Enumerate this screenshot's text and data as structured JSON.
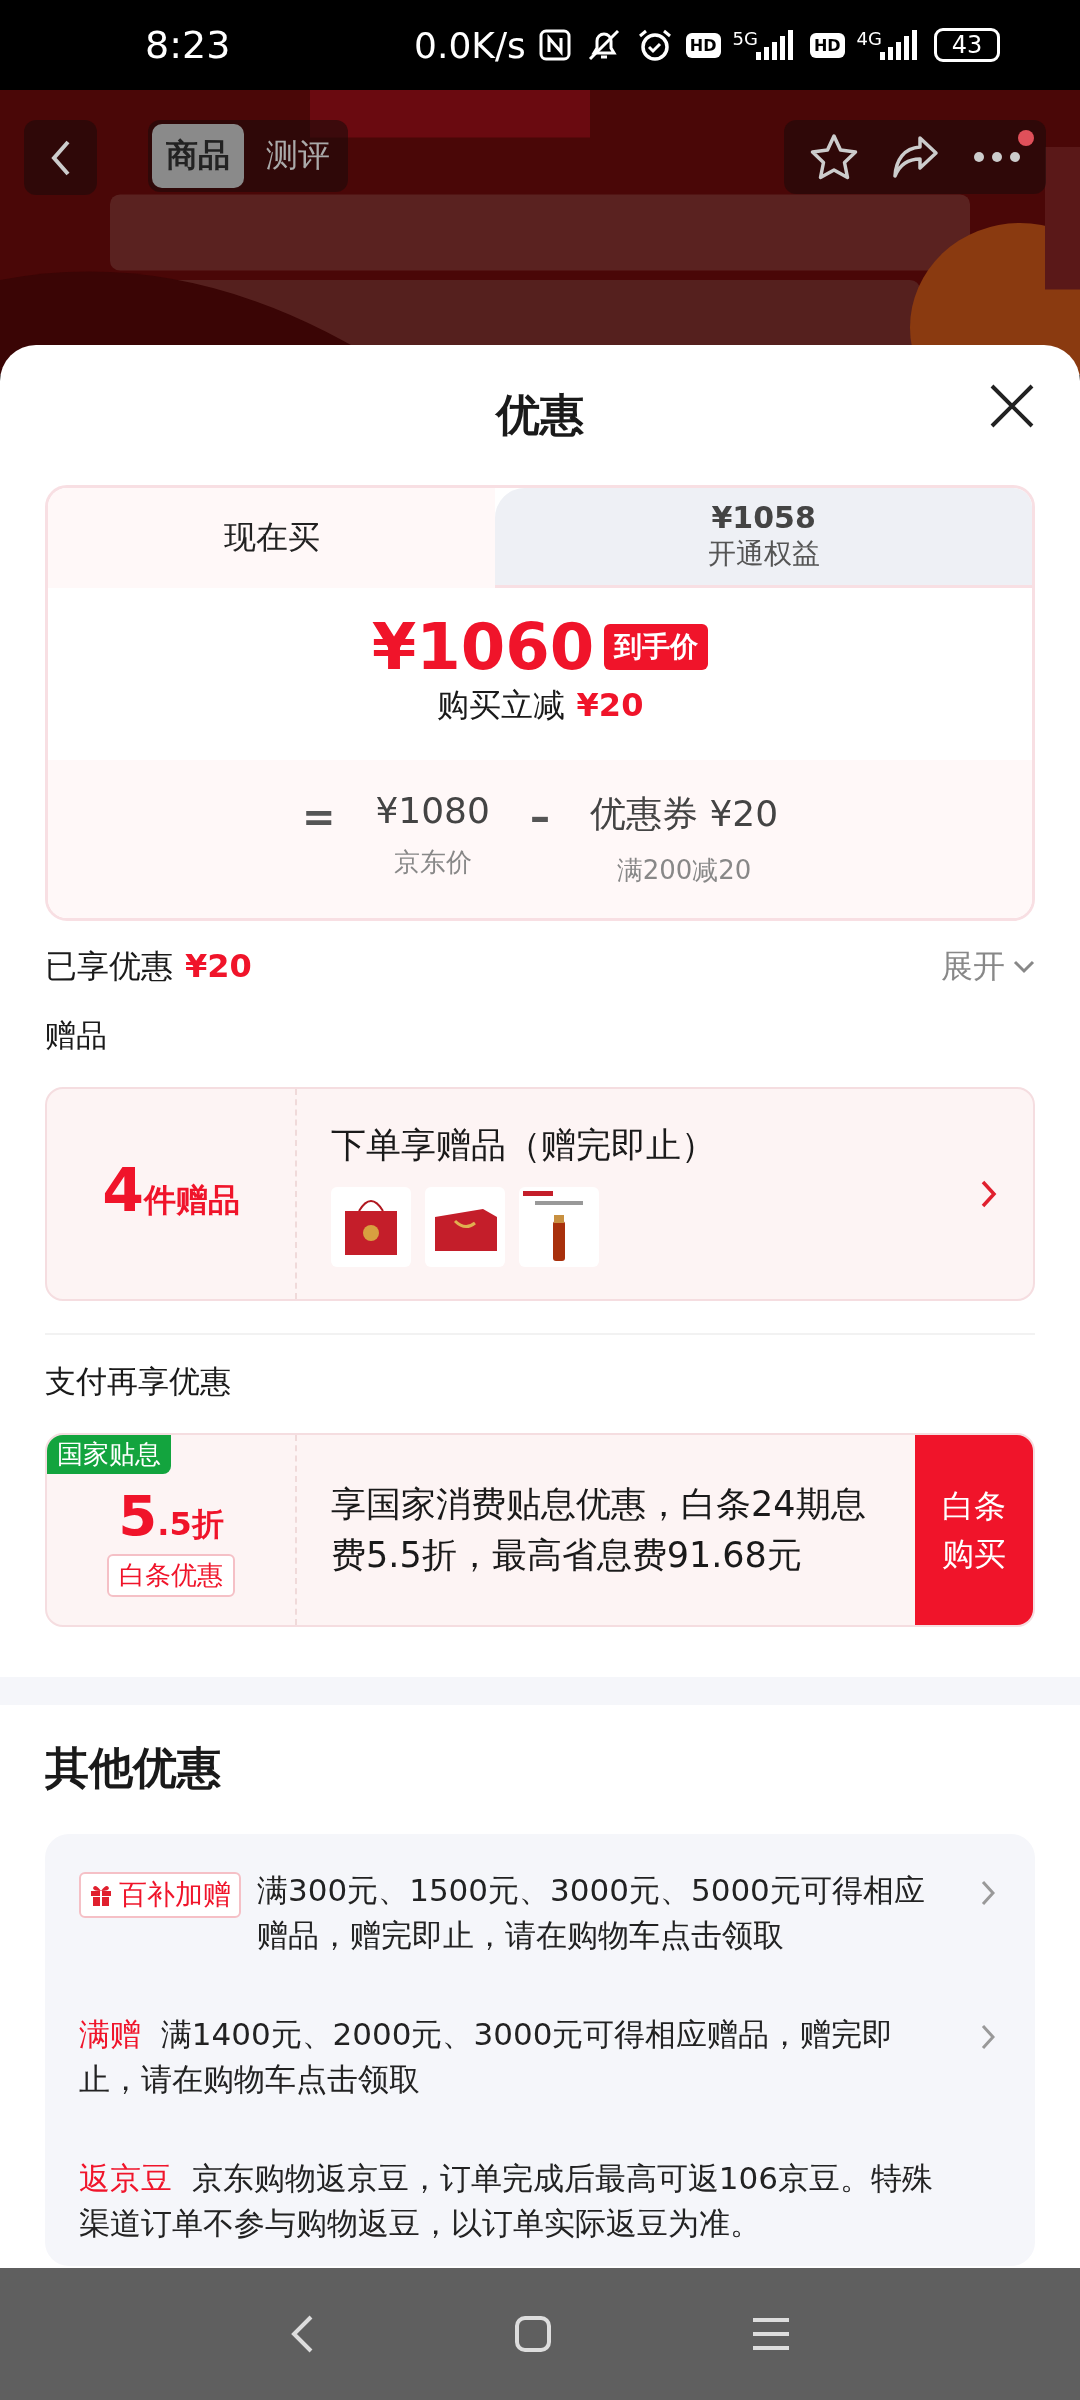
{
  "status_bar": {
    "time": "8:23",
    "network_speed": "0.0K/s",
    "sims": [
      {
        "badge": "HD",
        "network": "5G"
      },
      {
        "badge": "HD",
        "network": "4G"
      }
    ],
    "battery": "43"
  },
  "nav": {
    "tabs": [
      {
        "label": "商品",
        "selected": true
      },
      {
        "label": "测评",
        "selected": false
      }
    ],
    "notification_dot": true
  },
  "sheet": {
    "title": "优惠"
  },
  "price_card": {
    "tabs": [
      {
        "label": "现在买",
        "selected": true
      },
      {
        "price": "¥1058",
        "label": "开通权益",
        "selected": false
      }
    ],
    "final_price": "¥1060",
    "price_tag": "到手价",
    "instant_label": "购买立减",
    "instant_amount": "¥20",
    "breakdown": [
      {
        "kind": "operator",
        "symbol": "="
      },
      {
        "kind": "term",
        "value": "¥1080",
        "caption": "京东价"
      },
      {
        "kind": "operator",
        "symbol": "–"
      },
      {
        "kind": "term",
        "value": "优惠券 ¥20",
        "caption": "满200减20"
      }
    ]
  },
  "enjoyed": {
    "label": "已享优惠",
    "amount": "¥20",
    "expand": "展开"
  },
  "gifts": {
    "heading": "赠品",
    "count": "4",
    "count_unit": "件赠品",
    "title": "下单享赠品（赠完即止）"
  },
  "payment": {
    "heading": "支付再享优惠",
    "badge": "国家贴息",
    "discount_major": "5",
    "discount_minor": ".5折",
    "tag": "白条优惠",
    "description": "享国家消费贴息优惠，白条24期息费5.5折，最高省息费91.68元",
    "button": "白条购买"
  },
  "other": {
    "heading": "其他优惠",
    "items": [
      {
        "kind": "boxed",
        "tag": "百补加赠",
        "text": "满300元、1500元、3000元、5000元可得相应赠品，赠完即止，请在购物车点击领取",
        "arrow": true
      },
      {
        "kind": "inline",
        "tag": "满赠",
        "text": "满1400元、2000元、3000元可得相应赠品，赠完即止，请在购物车点击领取",
        "arrow": true
      },
      {
        "kind": "inline",
        "tag": "返京豆",
        "text": "京东购物返京豆，订单完成后最高可返106京豆。特殊渠道订单不参与购物返豆，以订单实际返豆为准。",
        "arrow": false
      }
    ]
  }
}
